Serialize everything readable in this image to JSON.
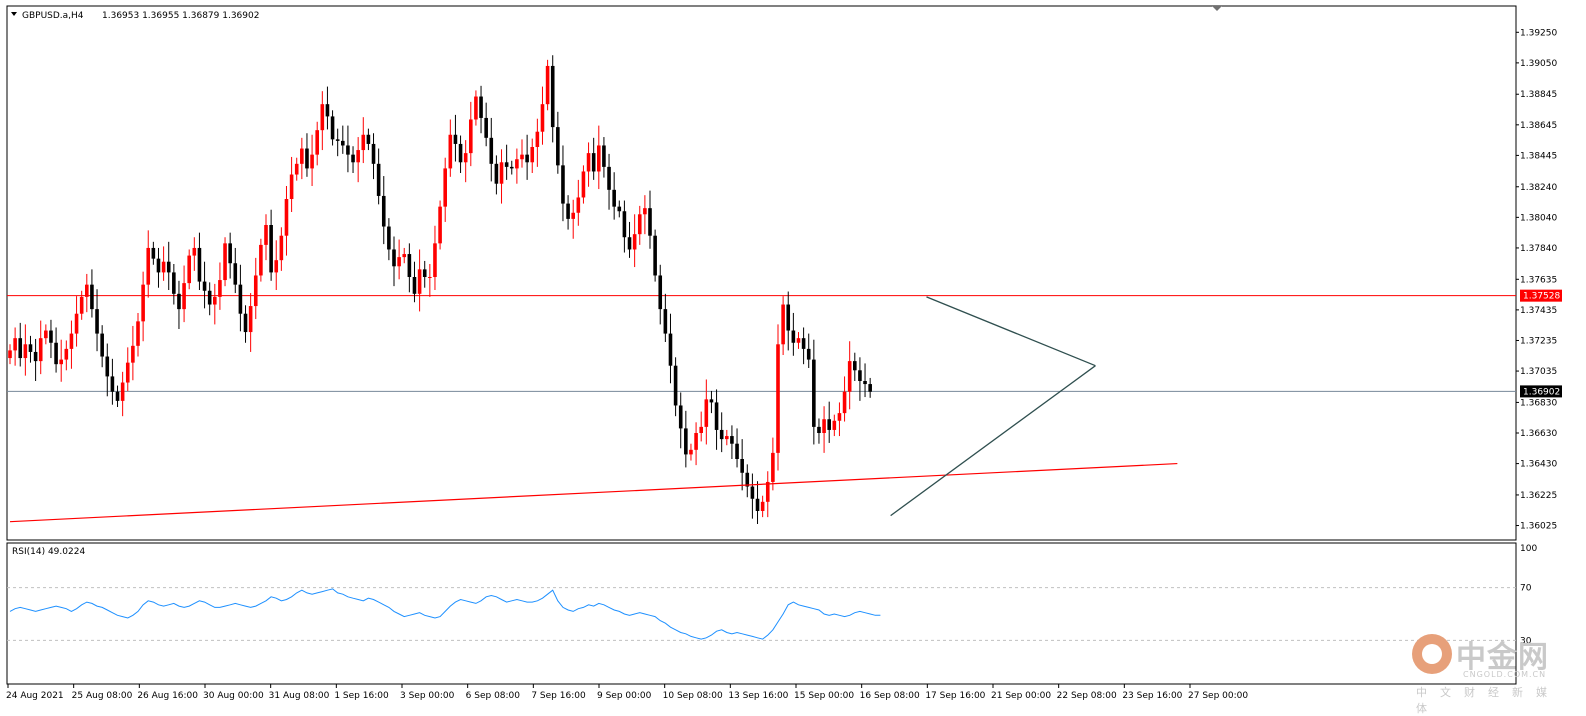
{
  "header": {
    "symbol": "GBPUSD.a,H4",
    "ohlc": "1.36953 1.36955 1.36879 1.36902",
    "rsi_label": "RSI(14) 49.0224"
  },
  "colors": {
    "bull": "#ff0000",
    "bear": "#000000",
    "resistance": "#ff0000",
    "trendline": "#ff0000",
    "current_line": "#778899",
    "triangle": "#2f4f4f",
    "rsi_line": "#1e90ff",
    "grid": "#c0c0c0"
  },
  "logo": {
    "name_cn": "中金网",
    "name_en": "CNGOLD.COM.CN",
    "slogan": "中文财经新媒体"
  },
  "chart_data": [
    {
      "type": "candlestick",
      "title": "GBPUSD.a,H4",
      "ylim": [
        1.3595,
        1.3935
      ],
      "y_ticks": [
        "1.39250",
        "1.39050",
        "1.38845",
        "1.38645",
        "1.38445",
        "1.38240",
        "1.38040",
        "1.37840",
        "1.37635",
        "1.37435",
        "1.37235",
        "1.37035",
        "1.36830",
        "1.36630",
        "1.36430",
        "1.36225",
        "1.36025"
      ],
      "x_ticks": [
        "24 Aug 2021",
        "25 Aug 08:00",
        "26 Aug 16:00",
        "30 Aug 00:00",
        "31 Aug 08:00",
        "1 Sep 16:00",
        "3 Sep 00:00",
        "6 Sep 08:00",
        "7 Sep 16:00",
        "9 Sep 00:00",
        "10 Sep 08:00",
        "13 Sep 16:00",
        "15 Sep 00:00",
        "16 Sep 08:00",
        "17 Sep 16:00",
        "21 Sep 00:00",
        "22 Sep 08:00",
        "23 Sep 16:00",
        "27 Sep 00:00"
      ],
      "price_levels": [
        {
          "label": "1.37528",
          "value": 1.37528,
          "style": "resistance"
        },
        {
          "label": "1.36902",
          "value": 1.36902,
          "style": "current"
        }
      ],
      "trendline": {
        "from": [
          0,
          1.3605
        ],
        "to": [
          228,
          1.3643
        ]
      },
      "triangle": {
        "upper": [
          [
            179,
            1.3752
          ],
          [
            212,
            1.3707
          ]
        ],
        "lower": [
          [
            172,
            1.3609
          ],
          [
            212,
            1.3707
          ]
        ]
      },
      "close_values": [
        1.3717,
        1.3725,
        1.3712,
        1.3721,
        1.3716,
        1.371,
        1.3725,
        1.373,
        1.3722,
        1.3708,
        1.3711,
        1.3718,
        1.3728,
        1.3741,
        1.3752,
        1.376,
        1.3744,
        1.3728,
        1.3713,
        1.37,
        1.369,
        1.3684,
        1.3696,
        1.3709,
        1.372,
        1.3736,
        1.376,
        1.3784,
        1.3777,
        1.3768,
        1.3775,
        1.3768,
        1.3754,
        1.3744,
        1.3761,
        1.3779,
        1.3784,
        1.3762,
        1.3756,
        1.3747,
        1.3752,
        1.3763,
        1.3787,
        1.3774,
        1.376,
        1.3741,
        1.3729,
        1.3746,
        1.3766,
        1.3786,
        1.3799,
        1.3768,
        1.3776,
        1.3792,
        1.3816,
        1.3832,
        1.3839,
        1.3849,
        1.3836,
        1.3845,
        1.3861,
        1.3878,
        1.387,
        1.3855,
        1.3854,
        1.3851,
        1.3845,
        1.384,
        1.3848,
        1.3858,
        1.3852,
        1.3839,
        1.3818,
        1.3798,
        1.3783,
        1.3772,
        1.3778,
        1.378,
        1.3765,
        1.3754,
        1.377,
        1.3765,
        1.3765,
        1.3787,
        1.3811,
        1.3836,
        1.3858,
        1.3852,
        1.384,
        1.3846,
        1.3868,
        1.3883,
        1.3869,
        1.3856,
        1.3839,
        1.3826,
        1.384,
        1.3837,
        1.3836,
        1.3842,
        1.3845,
        1.384,
        1.385,
        1.386,
        1.3878,
        1.3903,
        1.3863,
        1.3838,
        1.3813,
        1.3803,
        1.3807,
        1.3817,
        1.3834,
        1.3846,
        1.3834,
        1.3851,
        1.3837,
        1.3822,
        1.3811,
        1.3808,
        1.3791,
        1.3783,
        1.3793,
        1.3806,
        1.381,
        1.3792,
        1.3766,
        1.3744,
        1.3728,
        1.3707,
        1.3681,
        1.3666,
        1.3649,
        1.3652,
        1.3663,
        1.3667,
        1.3685,
        1.3683,
        1.3665,
        1.3659,
        1.3661,
        1.3656,
        1.3646,
        1.3637,
        1.3628,
        1.362,
        1.3612,
        1.3618,
        1.3631,
        1.365,
        1.3721,
        1.3747,
        1.373,
        1.3722,
        1.3725,
        1.3718,
        1.3711,
        1.3667,
        1.3663,
        1.3672,
        1.3665,
        1.3671,
        1.3676,
        1.369,
        1.371,
        1.3704,
        1.3697,
        1.3695,
        1.369
      ],
      "rsi": {
        "title": "RSI(14) 49.0224",
        "ylim": [
          0,
          100
        ],
        "y_ticks": [
          "100",
          "70",
          "30"
        ],
        "levels": [
          70,
          30
        ],
        "values": [
          52,
          54,
          55,
          54,
          53,
          52,
          53,
          54,
          55,
          56,
          55,
          54,
          52,
          54,
          57,
          59,
          58,
          56,
          55,
          53,
          51,
          49,
          48,
          47,
          49,
          52,
          57,
          60,
          59,
          57,
          56,
          57,
          58,
          56,
          55,
          56,
          58,
          60,
          59,
          57,
          55,
          55,
          56,
          57,
          58,
          57,
          56,
          55,
          56,
          58,
          60,
          63,
          62,
          60,
          61,
          63,
          66,
          68,
          66,
          65,
          66,
          67,
          68,
          69,
          66,
          65,
          63,
          62,
          61,
          60,
          62,
          61,
          59,
          57,
          55,
          52,
          50,
          48,
          49,
          50,
          51,
          49,
          48,
          47,
          48,
          52,
          56,
          59,
          61,
          60,
          59,
          58,
          60,
          63,
          64,
          63,
          61,
          59,
          60,
          61,
          60,
          59,
          59,
          60,
          62,
          65,
          68,
          60,
          55,
          53,
          52,
          54,
          55,
          57,
          56,
          58,
          57,
          55,
          53,
          52,
          50,
          49,
          50,
          51,
          50,
          49,
          48,
          45,
          43,
          40,
          38,
          36,
          35,
          33,
          32,
          31,
          32,
          34,
          37,
          38,
          36,
          35,
          36,
          35,
          34,
          33,
          32,
          31,
          34,
          38,
          44,
          50,
          57,
          59,
          57,
          56,
          55,
          54,
          53,
          50,
          49,
          50,
          49,
          48,
          49,
          51,
          52,
          51,
          50,
          49,
          49
        ]
      }
    }
  ]
}
